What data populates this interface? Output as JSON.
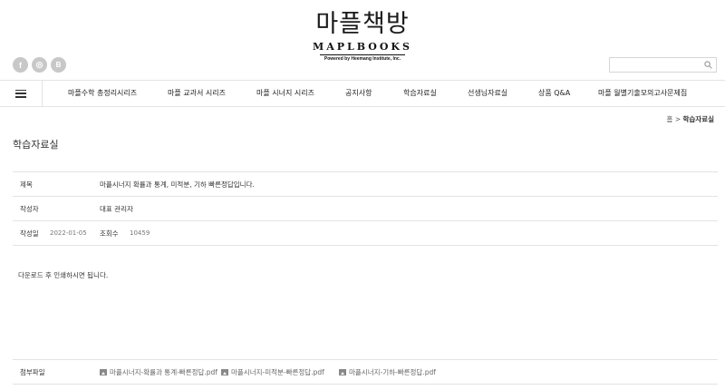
{
  "brand": {
    "korean": "마플책방",
    "english": "MAPLBOOKS",
    "powered": "Powered by Heemang Institute, Inc."
  },
  "social": [
    {
      "icon": "facebook-icon",
      "glyph": "f"
    },
    {
      "icon": "instagram-icon",
      "glyph": "◎"
    },
    {
      "icon": "blog-icon",
      "glyph": "B"
    }
  ],
  "search": {
    "value": "",
    "placeholder": ""
  },
  "nav": {
    "items": [
      "마플수학 총정리시리즈",
      "마플 교과서 시리즈",
      "마플 시너지 시리즈",
      "공지사항",
      "학습자료실",
      "선생님자료실",
      "상품 Q&A",
      "마플 월별기출모의고사문제집"
    ]
  },
  "breadcrumb": {
    "home": "홈",
    "separator": ">",
    "current": "학습자료실"
  },
  "page_title": "학습자료실",
  "post": {
    "title_label": "제목",
    "title": "마플시너지 확률과 통계, 미적분, 기하 빠른정답입니다.",
    "author_label": "작성자",
    "author": "대표 관리자",
    "date_label": "작성일",
    "date": "2022-01-05",
    "views_label": "조회수",
    "views": "10459",
    "content": "다운로드 후 인쇄하시면 됩니다."
  },
  "attachments": {
    "label": "첨부파일",
    "files": [
      "마플시너지-확률과 통계-빠른정답.pdf",
      "마플시너지-미적분-빠른정답.pdf",
      "마플시너지-기하-빠른정답.pdf"
    ]
  }
}
